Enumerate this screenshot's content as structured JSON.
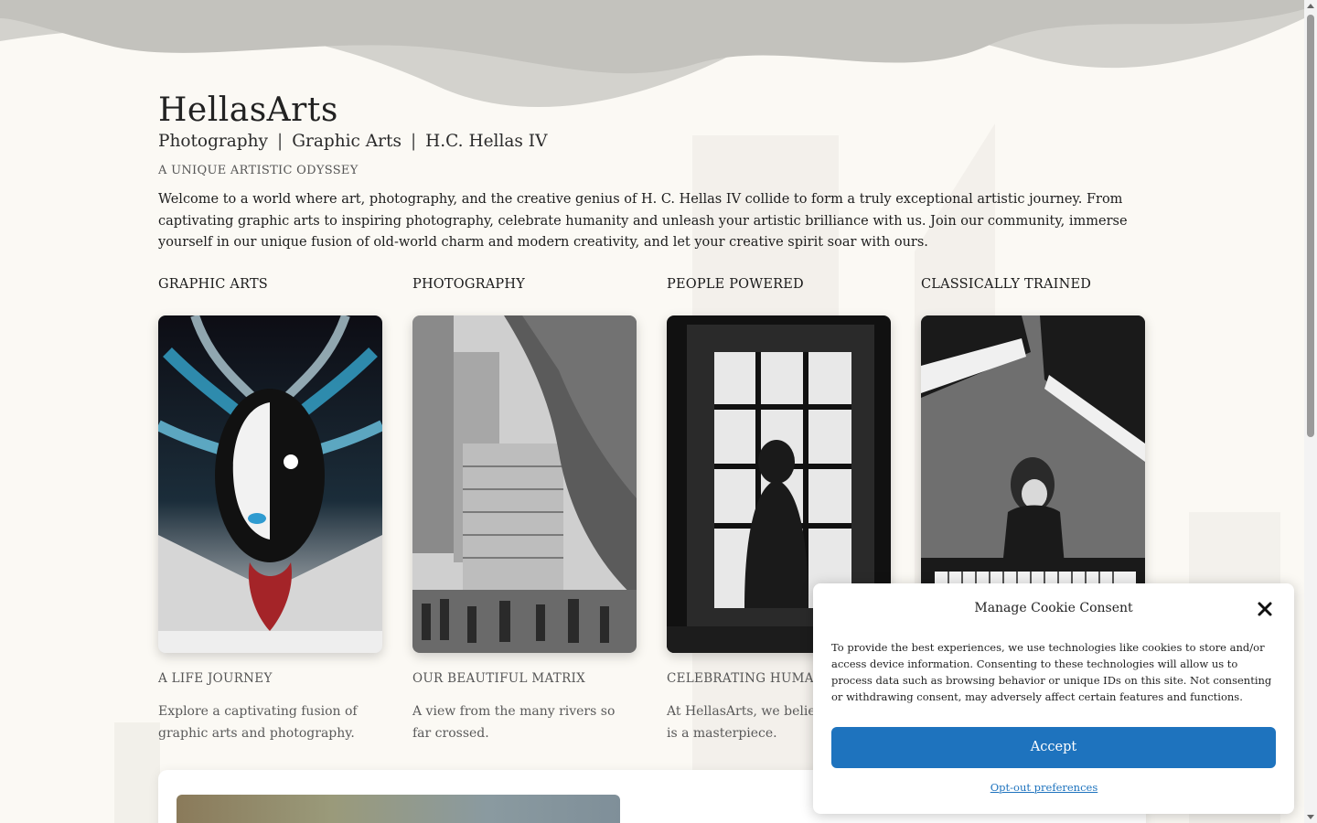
{
  "site": {
    "title": "HellasArts",
    "tagline": [
      "Photography",
      "Graphic Arts",
      "H.C. Hellas IV"
    ],
    "tagline_separator": "|",
    "kicker": "A UNIQUE ARTISTIC ODYSSEY",
    "intro": "Welcome to a world where art, photography, and the creative genius of H. C. Hellas IV collide to form a truly exceptional artistic journey. From captivating graphic arts to inspiring photography, celebrate humanity and unleash your artistic brilliance with us. Join our community, immerse yourself in our unique fusion of old-world charm and modern creativity, and let your creative spirit soar with ours."
  },
  "cards": [
    {
      "title": "GRAPHIC ARTS",
      "subtitle": "A LIFE JOURNEY",
      "text": "Explore a captivating fusion of graphic arts and photography."
    },
    {
      "title": "PHOTOGRAPHY",
      "subtitle": "OUR BEAUTIFUL MATRIX",
      "text": "A view from the many rivers so far crossed."
    },
    {
      "title": "PEOPLE POWERED",
      "subtitle": "CELEBRATING HUMANIT",
      "text": "At HellasArts, we believe t person is a masterpiece."
    },
    {
      "title": "CLASSICALLY TRAINED",
      "subtitle": "",
      "text": ""
    }
  ],
  "cookie": {
    "title": "Manage Cookie Consent",
    "body": "To provide the best experiences, we use technologies like cookies to store and/or access device information. Consenting to these technologies will allow us to process data such as browsing behavior or unique IDs on this site. Not consenting or withdrawing consent, may adversely affect certain features and functions.",
    "accept_label": "Accept",
    "optout_label": "Opt-out preferences",
    "close_icon": "close-icon"
  },
  "colors": {
    "background": "#fbf9f4",
    "wave": "#c9c8c3",
    "accent": "#1e73be"
  }
}
